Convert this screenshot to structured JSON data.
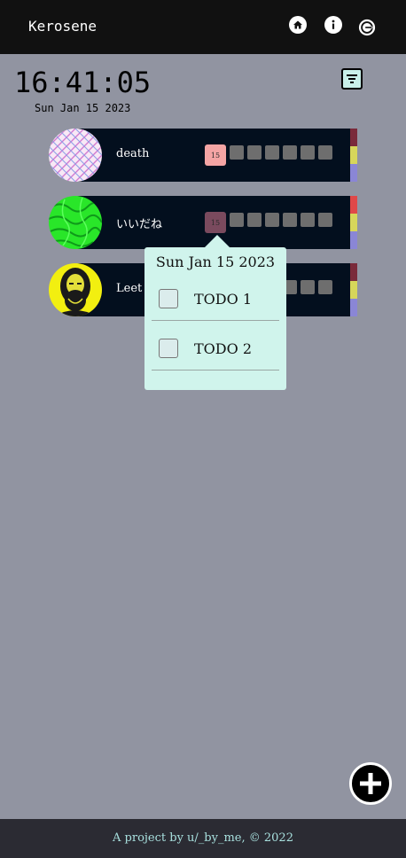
{
  "app": {
    "title": "Kerosene"
  },
  "nav": {
    "home_icon": "home-icon",
    "info_icon": "info-icon",
    "logout_icon": "logout-icon"
  },
  "clock": {
    "time": "16:41:05",
    "date": "Sun Jan 15 2023"
  },
  "toolbar": {
    "filter_icon": "filter-icon"
  },
  "habits": [
    {
      "name": "death",
      "avatar": "patterned-avatar",
      "today_day": "15",
      "today_color": "#f4a4a4",
      "stripe_colors": [
        "#7a2a3a",
        "#d7d65a",
        "#8a86d6"
      ]
    },
    {
      "name": "いいだね",
      "avatar": "green-avatar",
      "today_day": "15",
      "today_color": "#7a4a5e",
      "stripe_colors": [
        "#e04848",
        "#d7d65a",
        "#8a86d6"
      ]
    },
    {
      "name": "Leet c",
      "avatar": "portrait-avatar",
      "today_day": "",
      "today_color": "",
      "stripe_colors": [
        "#7a2a3a",
        "#d7d65a",
        "#8a86d6"
      ]
    }
  ],
  "popup": {
    "date": "Sun Jan 15 2023",
    "todos": [
      {
        "label": "TODO 1",
        "checked": false
      },
      {
        "label": "TODO 2",
        "checked": false
      }
    ]
  },
  "fab": {
    "icon": "plus-icon"
  },
  "footer": {
    "text": "A project by u/_by_me, © 2022"
  },
  "colors": {
    "background": "#9194a1",
    "topbar": "#111111",
    "card": "#030f1e",
    "popup": "#d0f4ec",
    "footer": "#2b2b33",
    "footer_text": "#a8e0de"
  }
}
